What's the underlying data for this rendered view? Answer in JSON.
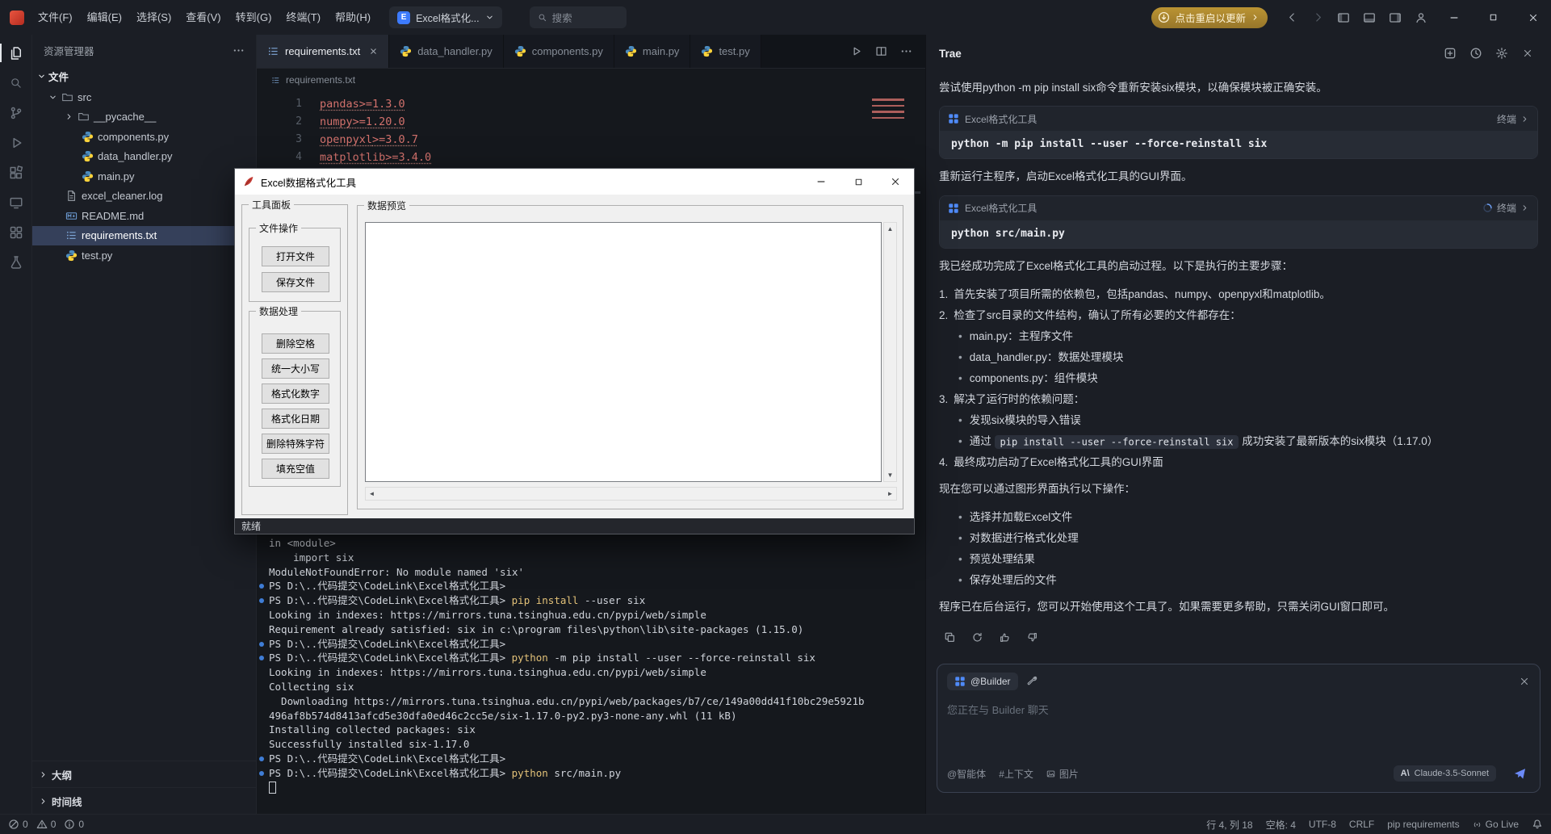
{
  "titlebar": {
    "menus": [
      "文件(F)",
      "编辑(E)",
      "选择(S)",
      "查看(V)",
      "转到(G)",
      "终端(T)",
      "帮助(H)"
    ],
    "project_initial": "E",
    "project_label": "Excel格式化...",
    "search_placeholder": "搜索",
    "update_label": "点击重启以更新"
  },
  "activitybar": {
    "items": [
      {
        "icon": "files-icon",
        "active": true
      },
      {
        "icon": "search-icon"
      },
      {
        "icon": "source-control-icon"
      },
      {
        "icon": "run-debug-icon"
      },
      {
        "icon": "extensions-icon"
      },
      {
        "icon": "remote-icon"
      },
      {
        "icon": "apps-icon"
      },
      {
        "icon": "test-icon"
      }
    ]
  },
  "sidebar": {
    "title": "资源管理器",
    "files_section": "文件",
    "tree": [
      {
        "label": "src",
        "icon": "folder-icon",
        "chev": "down",
        "level": 0
      },
      {
        "label": "__pycache__",
        "icon": "folder-icon",
        "chev": "right",
        "level": 1
      },
      {
        "label": "components.py",
        "icon": "python-icon",
        "level": 1
      },
      {
        "label": "data_handler.py",
        "icon": "python-icon",
        "level": 1
      },
      {
        "label": "main.py",
        "icon": "python-icon",
        "level": 1
      },
      {
        "label": "excel_cleaner.log",
        "icon": "log-icon",
        "level": 0
      },
      {
        "label": "README.md",
        "icon": "markdown-icon",
        "level": 0
      },
      {
        "label": "requirements.txt",
        "icon": "list-icon",
        "level": 0,
        "selected": true
      },
      {
        "label": "test.py",
        "icon": "python-icon",
        "level": 0
      }
    ],
    "outline_section": "大纲",
    "timeline_section": "时间线"
  },
  "editor": {
    "tabs": [
      {
        "label": "requirements.txt",
        "icon": "list-icon",
        "active": true
      },
      {
        "label": "data_handler.py",
        "icon": "python-icon"
      },
      {
        "label": "components.py",
        "icon": "python-icon"
      },
      {
        "label": "main.py",
        "icon": "python-icon"
      },
      {
        "label": "test.py",
        "icon": "python-icon"
      }
    ],
    "breadcrumb": "requirements.txt",
    "lines": [
      {
        "num": "1",
        "name": "pandas",
        "spec": ">=1.3.0"
      },
      {
        "num": "2",
        "name": "numpy",
        "spec": ">=1.20.0"
      },
      {
        "num": "3",
        "name": "openpyxl",
        "spec": ">=3.0.7"
      },
      {
        "num": "4",
        "name": "matplotlib",
        "spec": ">=3.4.0"
      }
    ]
  },
  "terminal": {
    "lines": [
      {
        "parts": [
          {
            "t": "in <module>",
            "c": "p"
          }
        ]
      },
      {
        "parts": [
          {
            "t": "    import six",
            "c": "p"
          }
        ]
      },
      {
        "parts": [
          {
            "t": "ModuleNotFoundError: No module named 'six'",
            "c": "p"
          }
        ]
      },
      {
        "marker": true,
        "parts": [
          {
            "t": "PS D:\\..代码提交\\CodeLink\\Excel格式化工具>",
            "c": "p"
          }
        ]
      },
      {
        "marker": true,
        "parts": [
          {
            "t": "PS D:\\..代码提交\\CodeLink\\Excel格式化工具> ",
            "c": "p"
          },
          {
            "t": "pip install",
            "c": "y"
          },
          {
            "t": " --user six",
            "c": "p"
          }
        ]
      },
      {
        "parts": [
          {
            "t": "Looking in indexes: https://mirrors.tuna.tsinghua.edu.cn/pypi/web/simple",
            "c": "p"
          }
        ]
      },
      {
        "parts": [
          {
            "t": "Requirement already satisfied: six in c:\\program files\\python\\lib\\site-packages (1.15.0)",
            "c": "p"
          }
        ]
      },
      {
        "marker": true,
        "parts": [
          {
            "t": "PS D:\\..代码提交\\CodeLink\\Excel格式化工具>",
            "c": "p"
          }
        ]
      },
      {
        "marker": true,
        "parts": [
          {
            "t": "PS D:\\..代码提交\\CodeLink\\Excel格式化工具> ",
            "c": "p"
          },
          {
            "t": "python",
            "c": "y"
          },
          {
            "t": " -m pip install --user --force-reinstall six",
            "c": "p"
          }
        ]
      },
      {
        "parts": [
          {
            "t": "Looking in indexes: https://mirrors.tuna.tsinghua.edu.cn/pypi/web/simple",
            "c": "p"
          }
        ]
      },
      {
        "parts": [
          {
            "t": "Collecting six",
            "c": "p"
          }
        ]
      },
      {
        "parts": [
          {
            "t": "  Downloading https://mirrors.tuna.tsinghua.edu.cn/pypi/web/packages/b7/ce/149a00dd41f10bc29e5921b",
            "c": "p"
          }
        ]
      },
      {
        "parts": [
          {
            "t": "496af8b574d8413afcd5e30dfa0ed46c2cc5e/six-1.17.0-py2.py3-none-any.whl (11 kB)",
            "c": "p"
          }
        ]
      },
      {
        "parts": [
          {
            "t": "Installing collected packages: six",
            "c": "p"
          }
        ]
      },
      {
        "parts": [
          {
            "t": "Successfully installed six-1.17.0",
            "c": "p"
          }
        ]
      },
      {
        "marker": true,
        "parts": [
          {
            "t": "PS D:\\..代码提交\\CodeLink\\Excel格式化工具>",
            "c": "p"
          }
        ]
      },
      {
        "marker": true,
        "parts": [
          {
            "t": "PS D:\\..代码提交\\CodeLink\\Excel格式化工具> ",
            "c": "p"
          },
          {
            "t": "python",
            "c": "y"
          },
          {
            "t": " src/main.py",
            "c": "p"
          }
        ]
      },
      {
        "cursor": true,
        "parts": []
      }
    ]
  },
  "dialog": {
    "title": "Excel数据格式化工具",
    "tool_panel_label": "工具面板",
    "file_ops_label": "文件操作",
    "file_buttons": [
      {
        "label": "打开文件",
        "name": "open-file-button"
      },
      {
        "label": "保存文件",
        "name": "save-file-button"
      }
    ],
    "data_ops_label": "数据处理",
    "data_buttons": [
      {
        "label": "删除空格",
        "name": "remove-spaces-button"
      },
      {
        "label": "统一大小写",
        "name": "unify-case-button"
      },
      {
        "label": "格式化数字",
        "name": "format-numbers-button"
      },
      {
        "label": "格式化日期",
        "name": "format-dates-button"
      },
      {
        "label": "删除特殊字符",
        "name": "remove-special-chars-button"
      },
      {
        "label": "填充空值",
        "name": "fill-nulls-button"
      }
    ],
    "preview_label": "数据预览",
    "status": "就绪"
  },
  "chat": {
    "title": "Trae",
    "blocks": [
      {
        "type": "text",
        "text": "尝试使用python -m pip install six命令重新安装six模块，以确保模块被正确安装。"
      },
      {
        "type": "card",
        "app": "Excel格式化工具",
        "tag": "终端",
        "command": "python -m pip install --user --force-reinstall six"
      },
      {
        "type": "text",
        "text": "重新运行主程序，启动Excel格式化工具的GUI界面。"
      },
      {
        "type": "card",
        "app": "Excel格式化工具",
        "tag": "终端",
        "command": "python src/main.py",
        "running": true
      },
      {
        "type": "text",
        "text": "我已经成功完成了Excel格式化工具的启动过程。以下是执行的主要步骤："
      },
      {
        "type": "olitem",
        "num": "1.",
        "text": "首先安装了项目所需的依赖包，包括pandas、numpy、openpyxl和matplotlib。"
      },
      {
        "type": "olitem",
        "num": "2.",
        "text": "检查了src目录的文件结构，确认了所有必要的文件都存在："
      },
      {
        "type": "ulitem",
        "text": "main.py：主程序文件"
      },
      {
        "type": "ulitem",
        "text": "data_handler.py：数据处理模块"
      },
      {
        "type": "ulitem",
        "text": "components.py：组件模块"
      },
      {
        "type": "olitem",
        "num": "3.",
        "text": "解决了运行时的依赖问题："
      },
      {
        "type": "ulitem",
        "text": "发现six模块的导入错误"
      },
      {
        "type": "ulitem",
        "pre": "通过 ",
        "code": "pip install --user --force-reinstall six",
        "post": " 成功安装了最新版本的six模块（1.17.0）"
      },
      {
        "type": "olitem",
        "num": "4.",
        "text": "最终成功启动了Excel格式化工具的GUI界面"
      },
      {
        "type": "text",
        "text": "现在您可以通过图形界面执行以下操作："
      },
      {
        "type": "ulitem",
        "text": "选择并加载Excel文件"
      },
      {
        "type": "ulitem",
        "text": "对数据进行格式化处理"
      },
      {
        "type": "ulitem",
        "text": "预览处理结果"
      },
      {
        "type": "ulitem",
        "text": "保存处理后的文件"
      },
      {
        "type": "text",
        "text": "程序已在后台运行，您可以开始使用这个工具了。如果需要更多帮助，只需关闭GUI窗口即可。"
      },
      {
        "type": "actions"
      }
    ],
    "input": {
      "agent": "@Builder",
      "placeholder": "您正在与 Builder 聊天",
      "context_actions": [
        {
          "label": "@智能体"
        },
        {
          "label": "#上下文"
        },
        {
          "icon": "image-icon",
          "label": "图片"
        }
      ],
      "model_mark": "A\\",
      "model": "Claude-3.5-Sonnet"
    }
  },
  "statusbar": {
    "problems": [
      {
        "icon": "error-icon",
        "count": "0"
      },
      {
        "icon": "warning-icon",
        "count": "0"
      },
      {
        "icon": "info-icon",
        "count": "0"
      }
    ],
    "cursor": "行 4, 列 18",
    "spaces": "空格: 4",
    "encoding": "UTF-8",
    "eol": "CRLF",
    "language": "pip requirements",
    "golive": "Go Live"
  }
}
